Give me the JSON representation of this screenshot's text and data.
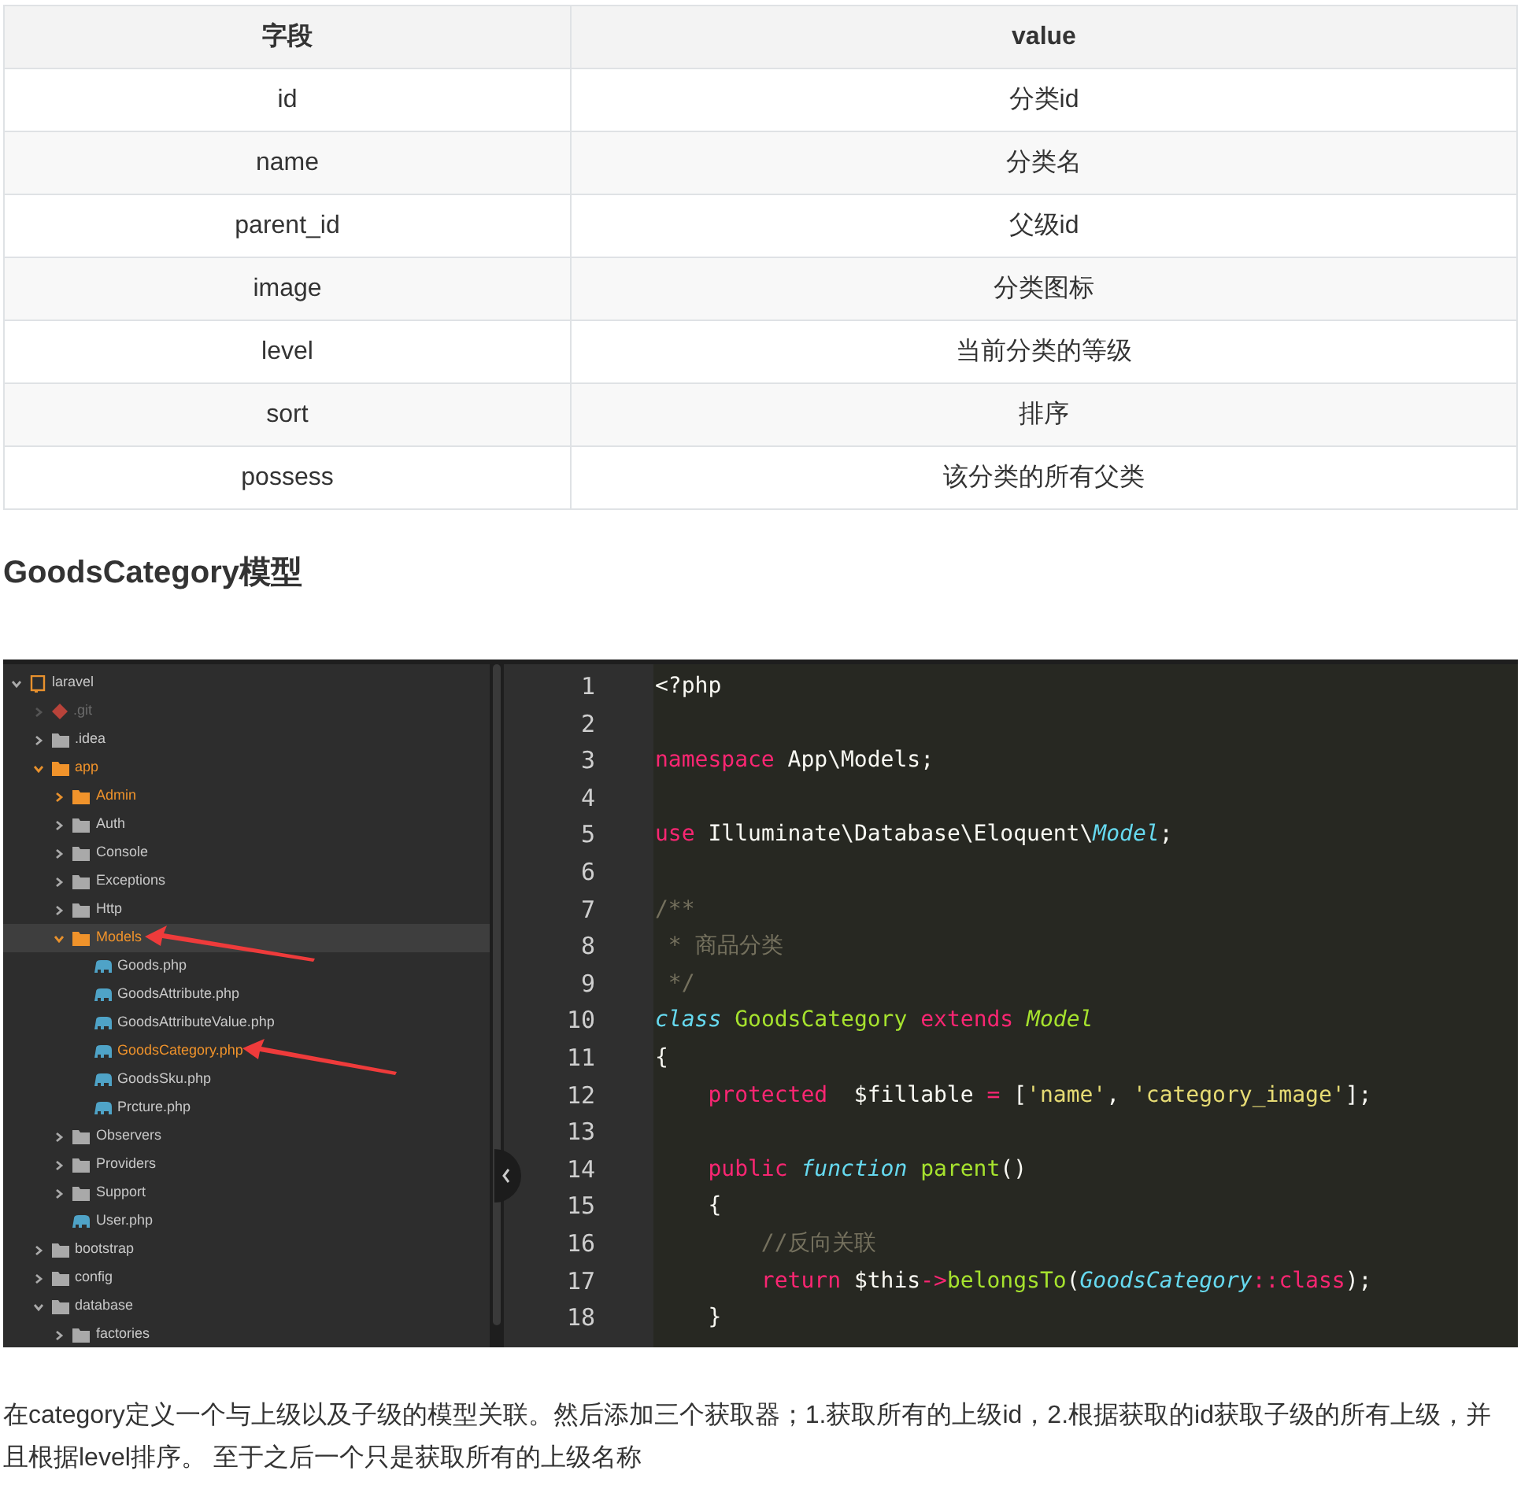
{
  "table": {
    "columns": [
      "字段",
      "value"
    ],
    "rows": [
      [
        "id",
        "分类id"
      ],
      [
        "name",
        "分类名"
      ],
      [
        "parent_id",
        "父级id"
      ],
      [
        "image",
        "分类图标"
      ],
      [
        "level",
        "当前分类的等级"
      ],
      [
        "sort",
        "排序"
      ],
      [
        "possess",
        "该分类的所有父类"
      ]
    ]
  },
  "heading": "GoodsCategory模型",
  "editor": {
    "tree": [
      {
        "kind": "project",
        "label": "laravel",
        "expanded": true,
        "highlighted": false,
        "selected": false,
        "children": [
          {
            "kind": "git",
            "label": ".git",
            "expanded": false,
            "highlighted": false,
            "selected": false
          },
          {
            "kind": "folder",
            "label": ".idea",
            "expanded": false,
            "highlighted": false,
            "selected": false
          },
          {
            "kind": "folder",
            "label": "app",
            "expanded": true,
            "highlighted": true,
            "selected": false,
            "children": [
              {
                "kind": "folder",
                "label": "Admin",
                "expanded": false,
                "highlighted": true,
                "selected": false
              },
              {
                "kind": "folder",
                "label": "Auth",
                "expanded": false,
                "highlighted": false,
                "selected": false
              },
              {
                "kind": "folder",
                "label": "Console",
                "expanded": false,
                "highlighted": false,
                "selected": false
              },
              {
                "kind": "folder",
                "label": "Exceptions",
                "expanded": false,
                "highlighted": false,
                "selected": false
              },
              {
                "kind": "folder",
                "label": "Http",
                "expanded": false,
                "highlighted": false,
                "selected": false
              },
              {
                "kind": "folder",
                "label": "Models",
                "expanded": true,
                "highlighted": true,
                "selected": true,
                "children": [
                  {
                    "kind": "file",
                    "label": "Goods.php",
                    "highlighted": false,
                    "selected": false
                  },
                  {
                    "kind": "file",
                    "label": "GoodsAttribute.php",
                    "highlighted": false,
                    "selected": false
                  },
                  {
                    "kind": "file",
                    "label": "GoodsAttributeValue.php",
                    "highlighted": false,
                    "selected": false
                  },
                  {
                    "kind": "file",
                    "label": "GoodsCategory.php",
                    "highlighted": true,
                    "selected": false
                  },
                  {
                    "kind": "file",
                    "label": "GoodsSku.php",
                    "highlighted": false,
                    "selected": false
                  },
                  {
                    "kind": "file",
                    "label": "Prcture.php",
                    "highlighted": false,
                    "selected": false
                  }
                ]
              },
              {
                "kind": "folder",
                "label": "Observers",
                "expanded": false,
                "highlighted": false,
                "selected": false
              },
              {
                "kind": "folder",
                "label": "Providers",
                "expanded": false,
                "highlighted": false,
                "selected": false
              },
              {
                "kind": "folder",
                "label": "Support",
                "expanded": false,
                "highlighted": false,
                "selected": false
              },
              {
                "kind": "file",
                "label": "User.php",
                "highlighted": false,
                "selected": false
              }
            ]
          },
          {
            "kind": "folder",
            "label": "bootstrap",
            "expanded": false,
            "highlighted": false,
            "selected": false
          },
          {
            "kind": "folder",
            "label": "config",
            "expanded": false,
            "highlighted": false,
            "selected": false
          },
          {
            "kind": "folder",
            "label": "database",
            "expanded": true,
            "highlighted": false,
            "selected": false,
            "children": [
              {
                "kind": "folder",
                "label": "factories",
                "expanded": false,
                "highlighted": false,
                "selected": false
              }
            ]
          }
        ]
      }
    ],
    "lines": [
      {
        "number": "1",
        "tokens": [
          {
            "kind": "plain",
            "text": "<?php"
          }
        ]
      },
      {
        "number": "2"
      },
      {
        "number": "3",
        "tokens": [
          {
            "kind": "keyword",
            "text": "namespace"
          },
          {
            "kind": "plain",
            "text": " App\\Models;"
          }
        ]
      },
      {
        "number": "4"
      },
      {
        "number": "5",
        "tokens": [
          {
            "kind": "keyword",
            "text": "use"
          },
          {
            "kind": "plain",
            "text": " Illuminate\\Database\\Eloquent\\"
          },
          {
            "kind": "type",
            "text": "Model"
          },
          {
            "kind": "plain",
            "text": ";"
          }
        ]
      },
      {
        "number": "6"
      },
      {
        "number": "7",
        "tokens": [
          {
            "kind": "comment",
            "text": "/**"
          }
        ]
      },
      {
        "number": "8",
        "tokens": [
          {
            "kind": "comment",
            "text": " * 商品分类"
          }
        ]
      },
      {
        "number": "9",
        "tokens": [
          {
            "kind": "comment",
            "text": " */"
          }
        ]
      },
      {
        "number": "10",
        "tokens": [
          {
            "kind": "type",
            "text": "class"
          },
          {
            "kind": "name",
            "text": " GoodsCategory"
          },
          {
            "kind": "keyword",
            "text": " extends"
          },
          {
            "kind": "parent",
            "text": " Model"
          }
        ]
      },
      {
        "number": "11",
        "tokens": [
          {
            "kind": "plain",
            "text": "{"
          }
        ]
      },
      {
        "number": "12",
        "tokens": [
          {
            "kind": "keyword",
            "text": "    protected"
          },
          {
            "kind": "plain",
            "text": "  $fillable "
          },
          {
            "kind": "keyword",
            "text": "="
          },
          {
            "kind": "plain",
            "text": " ["
          },
          {
            "kind": "string",
            "text": "'name'"
          },
          {
            "kind": "plain",
            "text": ", "
          },
          {
            "kind": "string",
            "text": "'category_image'"
          },
          {
            "kind": "plain",
            "text": "];"
          }
        ]
      },
      {
        "number": "13"
      },
      {
        "number": "14",
        "tokens": [
          {
            "kind": "keyword",
            "text": "    public"
          },
          {
            "kind": "type",
            "text": " function"
          },
          {
            "kind": "name",
            "text": " parent"
          },
          {
            "kind": "plain",
            "text": "()"
          }
        ]
      },
      {
        "number": "15",
        "tokens": [
          {
            "kind": "plain",
            "text": "    {"
          }
        ]
      },
      {
        "number": "16",
        "tokens": [
          {
            "kind": "comment",
            "text": "        //反向关联"
          }
        ]
      },
      {
        "number": "17",
        "tokens": [
          {
            "kind": "keyword",
            "text": "        return"
          },
          {
            "kind": "plain",
            "text": " $this"
          },
          {
            "kind": "keyword",
            "text": "->"
          },
          {
            "kind": "name",
            "text": "belongsTo"
          },
          {
            "kind": "plain",
            "text": "("
          },
          {
            "kind": "type",
            "text": "GoodsCategory"
          },
          {
            "kind": "keyword",
            "text": "::"
          },
          {
            "kind": "keyword",
            "text": "class"
          },
          {
            "kind": "plain",
            "text": ");"
          }
        ]
      },
      {
        "number": "18",
        "tokens": [
          {
            "kind": "plain",
            "text": "    }"
          }
        ]
      }
    ]
  },
  "paragraph": "在category定义一个与上级以及子级的模型关联。然后添加三个获取器；1.获取所有的上级id，2.根据获取的id获取子级的所有上级，并且根据level排序。 至于之后一个只是获取所有的上级名称"
}
